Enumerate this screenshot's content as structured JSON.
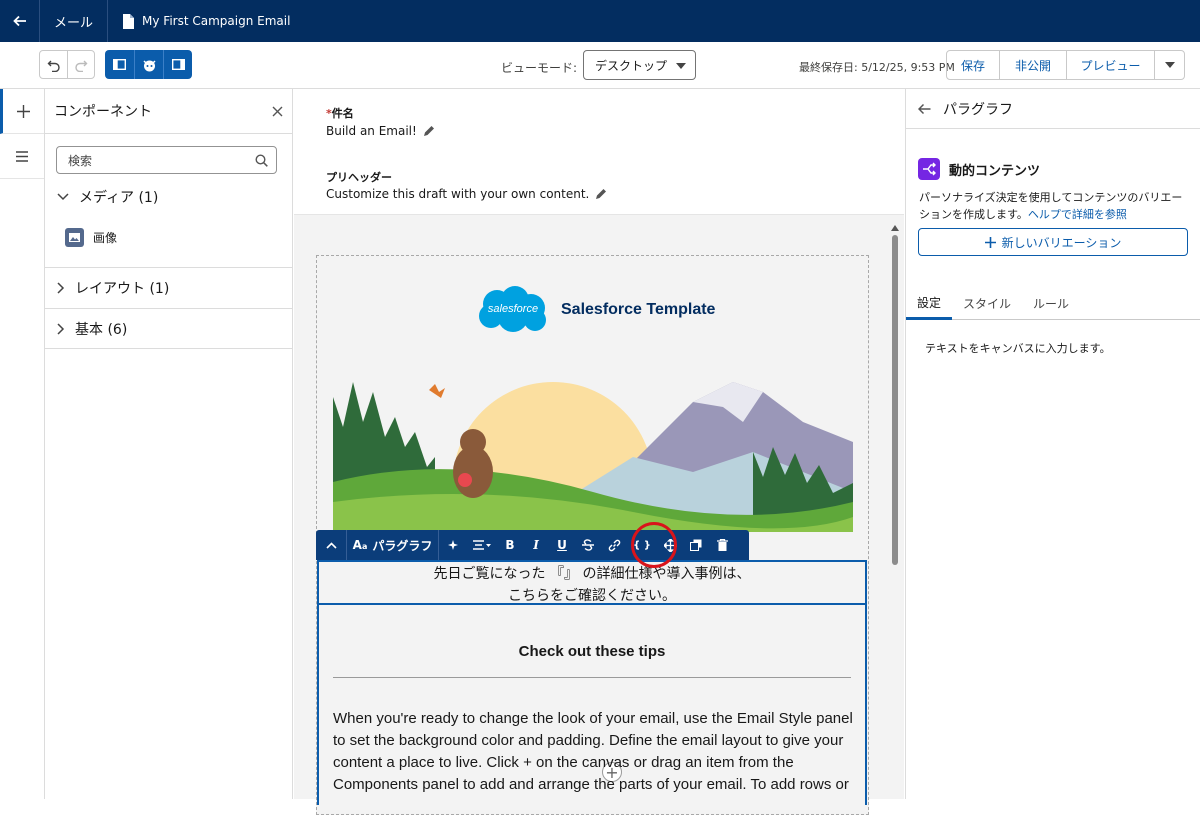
{
  "topbar": {
    "nav_label": "メール",
    "doc_title": "My First Campaign Email"
  },
  "toolbar": {
    "view_mode_label": "ビューモード:",
    "view_mode_value": "デスクトップ",
    "last_saved": "最終保存日: 5/12/25, 9:53 PM",
    "save": "保存",
    "unpublish": "非公開",
    "preview": "プレビュー"
  },
  "left_panel": {
    "title": "コンポーネント",
    "search_placeholder": "検索",
    "sections": [
      {
        "label": "メディア (1)",
        "expanded": true,
        "items": [
          "画像"
        ]
      },
      {
        "label": "レイアウト (1)",
        "expanded": false
      },
      {
        "label": "基本 (6)",
        "expanded": false
      }
    ]
  },
  "email": {
    "subject_label": "件名",
    "subject_required_mark": "*",
    "subject_value": "Build an Email!",
    "preheader_label": "プリヘッダー",
    "preheader_value": "Customize this draft with your own content.",
    "brand_cloud_text": "salesforce",
    "brand_title": "Salesforce Template",
    "paragraph_line1": "先日ご覧になった 『』 の詳細仕様や導入事例は、",
    "paragraph_line2": "こちらをご確認ください。",
    "tips_title": "Check out these tips",
    "tips_body": "When you're ready to change the look of your email, use the Email Style panel to set the background color and padding. Define the email layout to give your content a place to live. Click + on the canvas or drag an item from the Components panel to add and arrange the parts of your email. To add rows or"
  },
  "rte_toolbar": {
    "style_label": "パラグラフ",
    "bold": "B",
    "italic": "I",
    "underline": "U",
    "merge_field": "{ }"
  },
  "right_panel": {
    "title": "パラグラフ",
    "dc_title": "動的コンテンツ",
    "dc_desc": "パーソナライズ決定を使用してコンテンツのバリエーションを作成します。",
    "dc_help_link": "ヘルプで詳細を参照",
    "new_variation": "新しいバリエーション",
    "tabs": [
      "設定",
      "スタイル",
      "ルール"
    ],
    "active_tab": "設定",
    "body_text": "テキストをキャンバスに入力します。"
  },
  "colors": {
    "header_bg": "#032d60",
    "brand_blue": "#0b5cab",
    "highlight_red": "#d9141b",
    "dc_purple": "#7526e3"
  }
}
